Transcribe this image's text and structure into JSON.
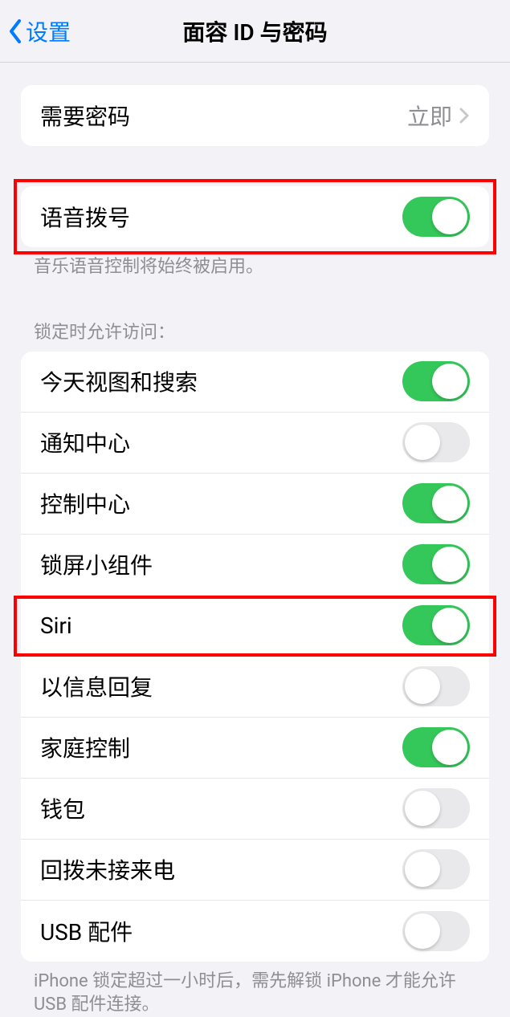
{
  "header": {
    "back_label": "设置",
    "title": "面容 ID 与密码"
  },
  "section1": {
    "require_passcode": {
      "label": "需要密码",
      "value": "立即"
    }
  },
  "section2": {
    "voice_dial": {
      "label": "语音拨号",
      "on": true
    },
    "footer": "音乐语音控制将始终被启用。"
  },
  "section3": {
    "header": "锁定时允许访问：",
    "items": [
      {
        "label": "今天视图和搜索",
        "on": true
      },
      {
        "label": "通知中心",
        "on": false
      },
      {
        "label": "控制中心",
        "on": true
      },
      {
        "label": "锁屏小组件",
        "on": true
      },
      {
        "label": "Siri",
        "on": true,
        "highlighted": true
      },
      {
        "label": "以信息回复",
        "on": false
      },
      {
        "label": "家庭控制",
        "on": true
      },
      {
        "label": "钱包",
        "on": false
      },
      {
        "label": "回拨未接来电",
        "on": false
      },
      {
        "label": "USB 配件",
        "on": false
      }
    ],
    "footer": "iPhone 锁定超过一小时后，需先解锁 iPhone 才能允许 USB 配件连接。"
  }
}
